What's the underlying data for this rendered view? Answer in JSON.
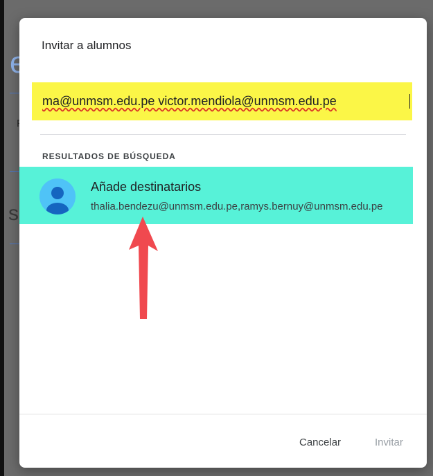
{
  "background": {
    "partial_char_1": "e",
    "partial_char_2": "P",
    "partial_char_3": "s"
  },
  "dialog": {
    "title": "Invitar a alumnos",
    "input": {
      "value": "ma@unmsm.edu.pe victor.mendiola@unmsm.edu.pe",
      "highlight_color": "#fbf647"
    },
    "section_label": "RESULTADOS DE BÚSQUEDA",
    "result": {
      "name": "Añade destinatarios",
      "emails": "thalia.bendezu@unmsm.edu.pe,ramys.bernuy@unmsm.edu.pe",
      "highlight_color": "#57f2d8",
      "avatar_icon": "person-avatar-icon"
    },
    "annotation": {
      "icon": "red-arrow-up-icon",
      "color": "#f0494f"
    },
    "buttons": {
      "cancel": "Cancelar",
      "invite": "Invitar"
    }
  }
}
